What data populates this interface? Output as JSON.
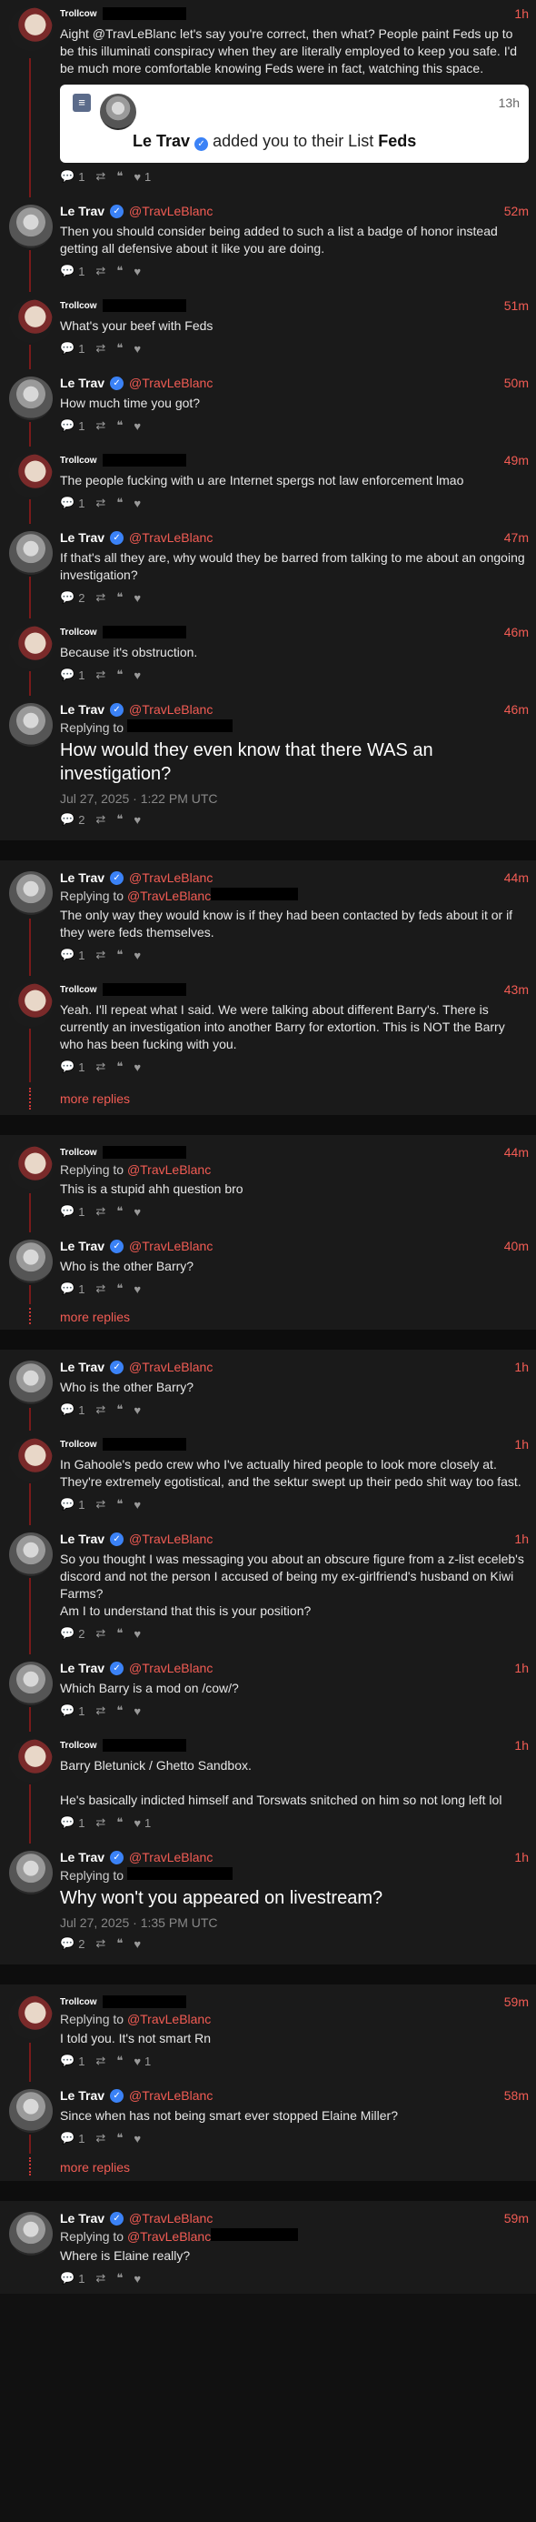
{
  "users": {
    "troll": {
      "name": "Trollcow"
    },
    "trav": {
      "name": "Le Trav",
      "handle": "@TravLeBlanc"
    }
  },
  "labels": {
    "replying_to": "Replying to",
    "more_replies": "more replies"
  },
  "icons": {
    "reply": "reply-icon",
    "repost": "repost-icon",
    "quote": "quote-icon",
    "like": "heart-icon",
    "verified": "verified-badge-icon",
    "list": "list-icon"
  },
  "colors": {
    "accent": "#f25c54",
    "background": "#1a1a1a",
    "verified": "#3b82f6"
  },
  "posts": [
    {
      "id": "p1",
      "time": "1h",
      "text": "Aight @TravLeBlanc let's say you're correct, then what? People paint Feds up to be this illuminati conspiracy when they are literally employed to keep you safe. I'd be much more comfortable knowing Feds were in fact, watching this space.",
      "replies": "1",
      "likes": "1",
      "embed": {
        "time": "13h",
        "name": "Le Trav",
        "text": "added you to their List",
        "list": "Feds"
      }
    },
    {
      "id": "p2",
      "time": "52m",
      "text": "Then you should consider being added to such a list a badge of honor instead getting all defensive about it like you are doing.",
      "replies": "1"
    },
    {
      "id": "p3",
      "time": "51m",
      "text": "What's your beef with Feds",
      "replies": "1"
    },
    {
      "id": "p4",
      "time": "50m",
      "text": "How much time you got?",
      "replies": "1"
    },
    {
      "id": "p5",
      "time": "49m",
      "text": "The people fucking with u are Internet spergs not law enforcement lmao",
      "replies": "1"
    },
    {
      "id": "p6",
      "time": "47m",
      "text": "If that's all they are, why would they be barred from talking to me about an ongoing investigation?",
      "replies": "2"
    },
    {
      "id": "p7",
      "time": "46m",
      "text": "Because it's obstruction.",
      "replies": "1"
    },
    {
      "id": "p8",
      "time": "46m",
      "text": "How would they even know that there WAS an investigation?",
      "date": "Jul 27, 2025 · 1:22 PM UTC",
      "replies": "2"
    },
    {
      "id": "p9",
      "time": "44m",
      "text": "The only way they would know is if they had been contacted by feds about it or if they were feds themselves.",
      "replies": "1"
    },
    {
      "id": "p10",
      "time": "43m",
      "text": "Yeah. I'll repeat what I said. We were talking about different Barry's. There is currently an investigation into another Barry for extortion. This is NOT the Barry who has been fucking with you.",
      "replies": "1"
    },
    {
      "id": "p11",
      "time": "44m",
      "text": "This is a stupid ahh question bro",
      "replies": "1"
    },
    {
      "id": "p12",
      "time": "40m",
      "text": "Who is the other Barry?",
      "replies": "1"
    },
    {
      "id": "p13",
      "time": "1h",
      "text": "Who is the other Barry?",
      "replies": "1"
    },
    {
      "id": "p14",
      "time": "1h",
      "text": "In Gahoole's pedo crew who I've actually hired people to look more closely at. They're extremely egotistical, and the sektur swept up their pedo shit way too fast.",
      "replies": "1"
    },
    {
      "id": "p15",
      "time": "1h",
      "text": "So you thought I was messaging you about an obscure figure from a z-list eceleb's discord and not the person I accused of being my ex-girlfriend's husband on Kiwi Farms?\nAm I to understand that this is your position?",
      "replies": "2"
    },
    {
      "id": "p16",
      "time": "1h",
      "text": "Which Barry is a mod on /cow/?",
      "replies": "1"
    },
    {
      "id": "p17",
      "time": "1h",
      "text": "Barry Bletunick / Ghetto Sandbox.\n\nHe's basically indicted himself and Torswats snitched on him so not long left lol",
      "replies": "1",
      "likes": "1"
    },
    {
      "id": "p18",
      "time": "1h",
      "text": "Why won't you appeared on livestream?",
      "date": "Jul 27, 2025 · 1:35 PM UTC",
      "replies": "2"
    },
    {
      "id": "p19",
      "time": "59m",
      "text": "I told you. It's not smart Rn",
      "replies": "1",
      "likes": "1"
    },
    {
      "id": "p20",
      "time": "58m",
      "text": "Since when has not being smart ever stopped Elaine Miller?",
      "replies": "1"
    },
    {
      "id": "p21",
      "time": "59m",
      "text": "Where is Elaine really?",
      "replies": "1"
    }
  ]
}
